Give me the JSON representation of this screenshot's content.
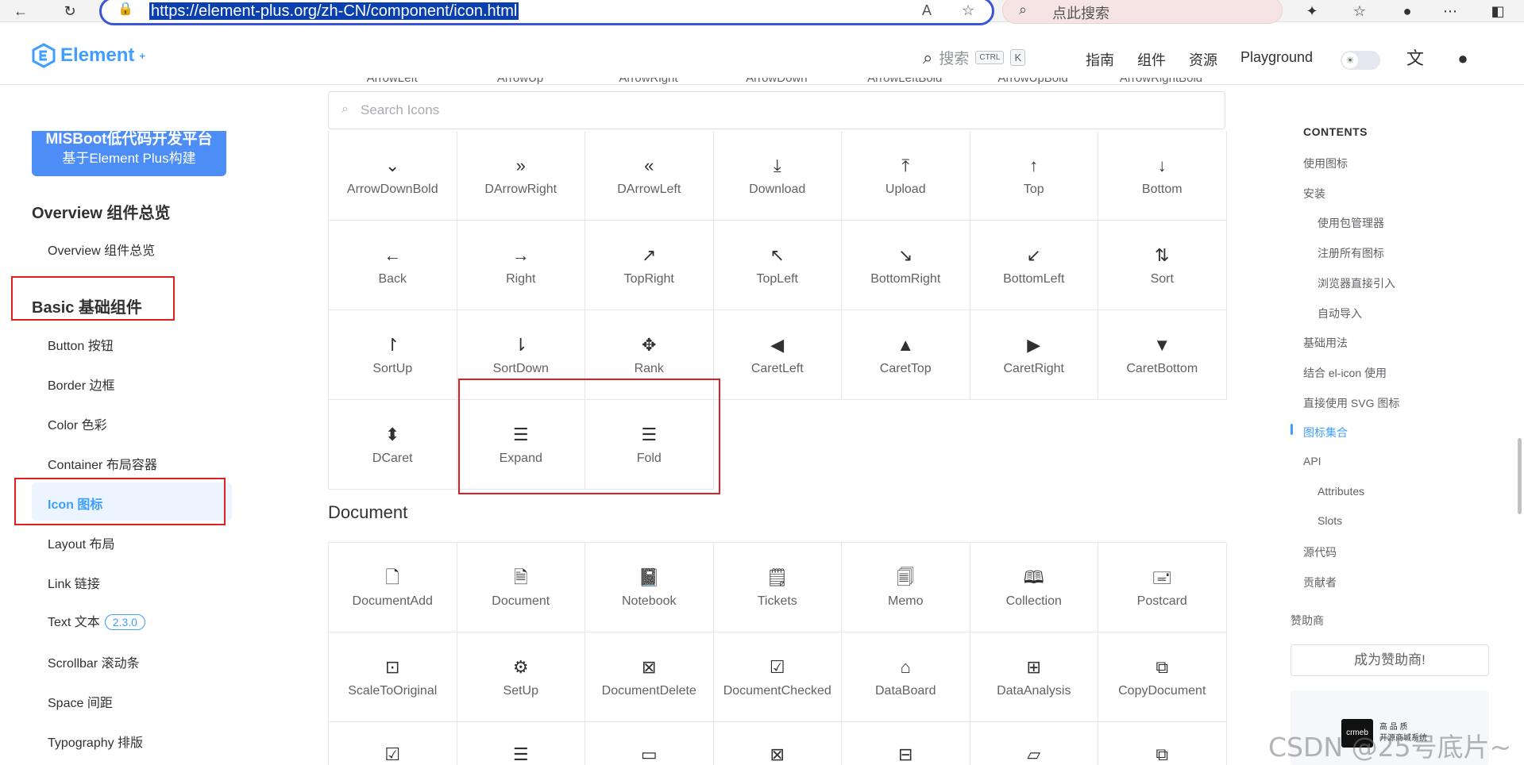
{
  "browser": {
    "url": "https://element-plus.org/zh-CN/component/icon.html",
    "search_placeholder": "点此搜索"
  },
  "header": {
    "logo_text": "Element",
    "logo_sup": "+",
    "search_label": "搜索",
    "kbd_ctrl": "CTRL",
    "kbd_k": "K",
    "nav": [
      "指南",
      "组件",
      "资源",
      "Playground"
    ]
  },
  "sidebar": {
    "promo_line1": "MISBoot低代码开发平台",
    "promo_line2": "基于Element Plus构建",
    "group_overview": "Overview 组件总览",
    "item_overview": "Overview 组件总览",
    "group_basic": "Basic 基础组件",
    "items": [
      "Button 按钮",
      "Border 边框",
      "Color 色彩",
      "Container 布局容器",
      "Icon 图标",
      "Layout 布局",
      "Link 链接",
      "Text 文本",
      "Scrollbar 滚动条",
      "Space 间距",
      "Typography 排版"
    ],
    "text_badge": "2.3.0"
  },
  "main": {
    "clipped_row": [
      "ArrowLeft",
      "ArrowUp",
      "ArrowRight",
      "ArrowDown",
      "ArrowLeftBold",
      "ArrowUpBold",
      "ArrowRightBold"
    ],
    "search_placeholder": "Search Icons",
    "arrow_icons": [
      {
        "name": "ArrowDownBold",
        "glyph": "⌄",
        "icon": "arrow-down-bold-icon"
      },
      {
        "name": "DArrowRight",
        "glyph": "»",
        "icon": "d-arrow-right-icon"
      },
      {
        "name": "DArrowLeft",
        "glyph": "«",
        "icon": "d-arrow-left-icon"
      },
      {
        "name": "Download",
        "glyph": "⤓",
        "icon": "download-icon"
      },
      {
        "name": "Upload",
        "glyph": "⤒",
        "icon": "upload-icon"
      },
      {
        "name": "Top",
        "glyph": "↑",
        "icon": "top-icon"
      },
      {
        "name": "Bottom",
        "glyph": "↓",
        "icon": "bottom-icon"
      },
      {
        "name": "Back",
        "glyph": "←",
        "icon": "back-icon"
      },
      {
        "name": "Right",
        "glyph": "→",
        "icon": "right-icon"
      },
      {
        "name": "TopRight",
        "glyph": "↗",
        "icon": "top-right-icon"
      },
      {
        "name": "TopLeft",
        "glyph": "↖",
        "icon": "top-left-icon"
      },
      {
        "name": "BottomRight",
        "glyph": "↘",
        "icon": "bottom-right-icon"
      },
      {
        "name": "BottomLeft",
        "glyph": "↙",
        "icon": "bottom-left-icon"
      },
      {
        "name": "Sort",
        "glyph": "⇅",
        "icon": "sort-icon"
      },
      {
        "name": "SortUp",
        "glyph": "↾",
        "icon": "sort-up-icon"
      },
      {
        "name": "SortDown",
        "glyph": "⇂",
        "icon": "sort-down-icon"
      },
      {
        "name": "Rank",
        "glyph": "✥",
        "icon": "rank-icon"
      },
      {
        "name": "CaretLeft",
        "glyph": "◀",
        "icon": "caret-left-icon"
      },
      {
        "name": "CaretTop",
        "glyph": "▲",
        "icon": "caret-top-icon"
      },
      {
        "name": "CaretRight",
        "glyph": "▶",
        "icon": "caret-right-icon"
      },
      {
        "name": "CaretBottom",
        "glyph": "▼",
        "icon": "caret-bottom-icon"
      },
      {
        "name": "DCaret",
        "glyph": "⬍",
        "icon": "d-caret-icon"
      },
      {
        "name": "Expand",
        "glyph": "☰",
        "icon": "expand-icon"
      },
      {
        "name": "Fold",
        "glyph": "☰",
        "icon": "fold-icon"
      }
    ],
    "document_title": "Document",
    "document_icons": [
      {
        "name": "DocumentAdd",
        "glyph": "🗋",
        "icon": "document-add-icon"
      },
      {
        "name": "Document",
        "glyph": "🗎",
        "icon": "document-icon"
      },
      {
        "name": "Notebook",
        "glyph": "📓",
        "icon": "notebook-icon"
      },
      {
        "name": "Tickets",
        "glyph": "🗒",
        "icon": "tickets-icon"
      },
      {
        "name": "Memo",
        "glyph": "🗐",
        "icon": "memo-icon"
      },
      {
        "name": "Collection",
        "glyph": "🕮",
        "icon": "collection-icon"
      },
      {
        "name": "Postcard",
        "glyph": "🖃",
        "icon": "postcard-icon"
      },
      {
        "name": "ScaleToOriginal",
        "glyph": "⊡",
        "icon": "scale-to-original-icon"
      },
      {
        "name": "SetUp",
        "glyph": "⚙",
        "icon": "setup-icon"
      },
      {
        "name": "DocumentDelete",
        "glyph": "⊠",
        "icon": "document-delete-icon"
      },
      {
        "name": "DocumentChecked",
        "glyph": "☑",
        "icon": "document-checked-icon"
      },
      {
        "name": "DataBoard",
        "glyph": "⌂",
        "icon": "data-board-icon"
      },
      {
        "name": "DataAnalysis",
        "glyph": "⊞",
        "icon": "data-analysis-icon"
      },
      {
        "name": "CopyDocument",
        "glyph": "⧉",
        "icon": "copy-document-icon"
      },
      {
        "name": "",
        "glyph": "☑",
        "icon": "folder-checked-icon"
      },
      {
        "name": "",
        "glyph": "☰",
        "icon": "files-icon"
      },
      {
        "name": "",
        "glyph": "▭",
        "icon": "folder-icon"
      },
      {
        "name": "",
        "glyph": "⊠",
        "icon": "folder-delete-icon"
      },
      {
        "name": "",
        "glyph": "⊟",
        "icon": "folder-remove-icon"
      },
      {
        "name": "",
        "glyph": "▱",
        "icon": "folder-opened-icon"
      },
      {
        "name": "",
        "glyph": "⧉",
        "icon": "document-copy-icon"
      }
    ]
  },
  "toc": {
    "title": "CONTENTS",
    "items": [
      {
        "label": "使用图标",
        "level": 1
      },
      {
        "label": "安装",
        "level": 1
      },
      {
        "label": "使用包管理器",
        "level": 2
      },
      {
        "label": "注册所有图标",
        "level": 2
      },
      {
        "label": "浏览器直接引入",
        "level": 2
      },
      {
        "label": "自动导入",
        "level": 2
      },
      {
        "label": "基础用法",
        "level": 1
      },
      {
        "label": "结合 el-icon 使用",
        "level": 1
      },
      {
        "label": "直接使用 SVG 图标",
        "level": 1
      },
      {
        "label": "图标集合",
        "level": 1,
        "active": true
      },
      {
        "label": "API",
        "level": 1
      },
      {
        "label": "Attributes",
        "level": 2
      },
      {
        "label": "Slots",
        "level": 2
      },
      {
        "label": "源代码",
        "level": 1
      },
      {
        "label": "贡献者",
        "level": 1
      }
    ],
    "sponsors_label": "赞助商",
    "sponsor_button": "成为赞助商!",
    "sponsor_logo_text": "crmeb",
    "sponsor_line1": "高 品 质",
    "sponsor_line2": "开源商城系统"
  },
  "watermark": "CSDN @25号底片~",
  "colors": {
    "accent": "#409eff",
    "highlight_box": "#e02020"
  }
}
